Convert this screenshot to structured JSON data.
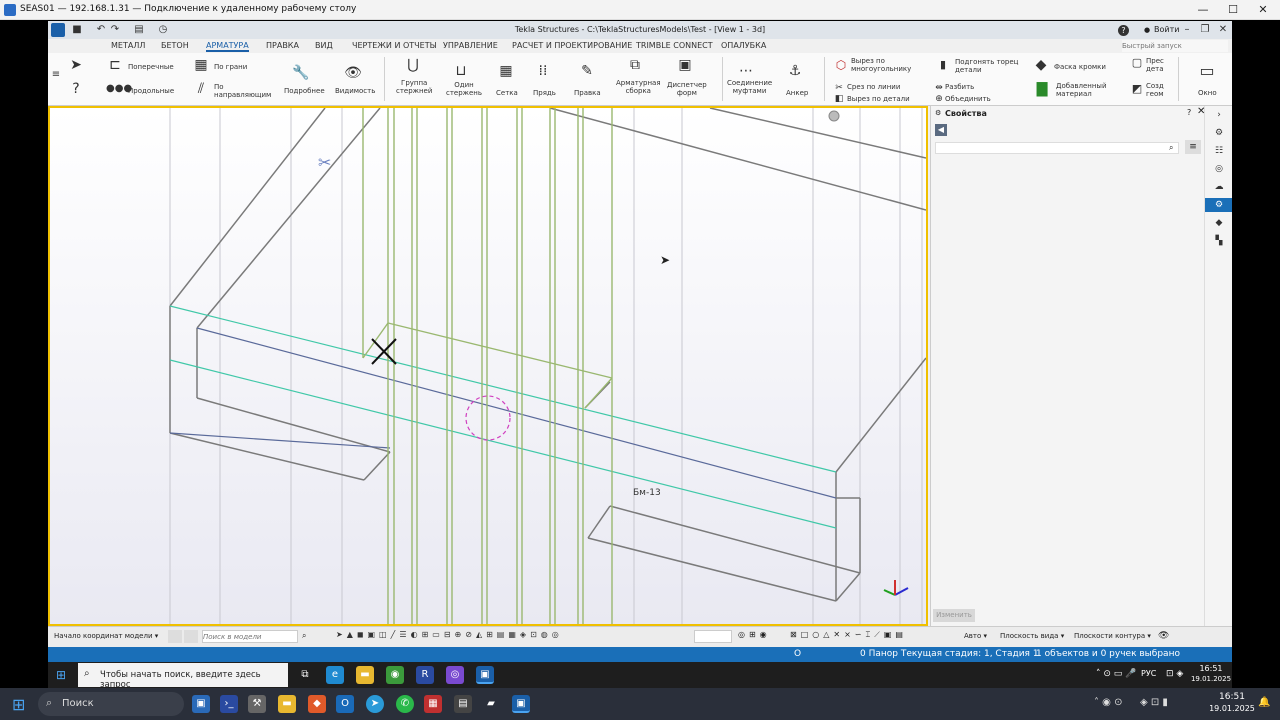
{
  "rdp": {
    "title": "SEAS01 — 192.168.1.31 — Подключение к удаленному рабочему столу",
    "minimize": "—",
    "maximize": "☐",
    "close": "✕"
  },
  "tekla": {
    "title": "Tekla Structures - C:\\TeklaStructuresModels\\Test - [View 1 - 3d]",
    "help": "?",
    "login": "Войти",
    "quick_search_placeholder": "Быстрый запуск"
  },
  "menu": {
    "tabs": [
      "МЕТАЛЛ",
      "БЕТОН",
      "АРМАТУРА",
      "ПРАВКА",
      "ВИД",
      "ЧЕРТЕЖИ И ОТЧЕТЫ",
      "УПРАВЛЕНИЕ",
      "РАСЧЕТ И ПРОЕКТИРОВАНИЕ",
      "TRIMBLE CONNECT",
      "ОПАЛУБКА"
    ],
    "active": "АРМАТУРА"
  },
  "ribbon": {
    "poperechnye": "Поперечные",
    "prodolnye": "Продольные",
    "po_grani": "По грани",
    "po_napravl_1": "По",
    "po_napravl_2": "направляющим",
    "podrobnee": "Подробнее",
    "vidimost": "Видимость",
    "gruppa_1": "Группа",
    "gruppa_2": "стержней",
    "odin_1": "Один",
    "odin_2": "стержень",
    "setka": "Сетка",
    "pryad": "Прядь",
    "pravka": "Правка",
    "arm_sborka_1": "Арматурная",
    "arm_sborka_2": "сборка",
    "dispetcher_1": "Диспетчер",
    "dispetcher_2": "форм",
    "soed_1": "Соединение",
    "soed_2": "муфтами",
    "anker": "Анкер",
    "vyrez_mnog_1": "Вырез по",
    "vyrez_mnog_2": "многоугольнику",
    "srez_linii": "Срез по линии",
    "vyrez_detali": "Вырез по детали",
    "podgonat_1": "Подгонять торец",
    "podgonat_2": "детали",
    "razbit": "Разбить",
    "obedinit": "Объединить",
    "faska": "Фаска кромки",
    "dobav_1": "Добавленный",
    "dobav_2": "материал",
    "pres_1": "Прес",
    "pres_2": "дета",
    "sozd_1": "Созд",
    "sozd_2": "геом",
    "okno": "Окно"
  },
  "viewport": {
    "label_bm": "Бм-13"
  },
  "props": {
    "title": "Свойства",
    "apply_button": "Изменить"
  },
  "statusbar": {
    "origin": "Начало координат модели",
    "search_placeholder": "Поиск в модели",
    "auto": "Авто",
    "view_planes": "Плоскость вида",
    "contour_planes": "Плоскости контура"
  },
  "bottombar": {
    "o": "O",
    "stage": "0 Панор Текущая стадия: 1, Стадия 1",
    "selected": "1 объектов и 0 ручек выбрано"
  },
  "inner_taskbar": {
    "search": "Чтобы начать поиск, введите здесь запрос",
    "time": "16:51",
    "date": "19.01.2025",
    "lang": "РУС"
  },
  "taskbar": {
    "search": "Поиск",
    "time": "16:51",
    "date": "19.01.2025"
  }
}
